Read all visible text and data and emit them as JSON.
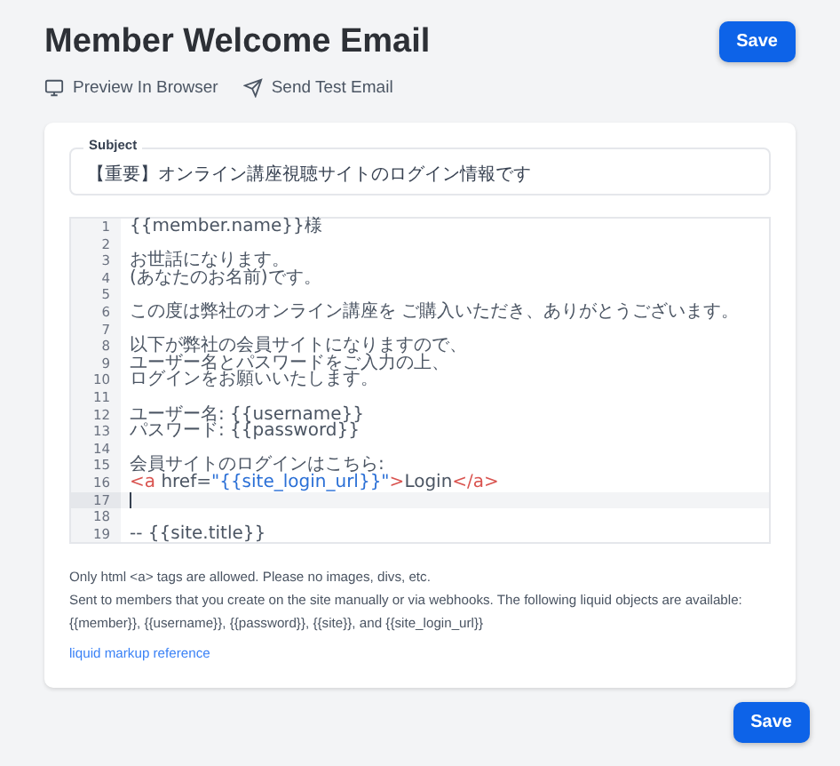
{
  "header": {
    "title": "Member Welcome Email",
    "save": "Save"
  },
  "actions": [
    {
      "kind": "preview",
      "label": "Preview In Browser"
    },
    {
      "kind": "send",
      "label": "Send Test Email"
    }
  ],
  "subject": {
    "label": "Subject",
    "value": "【重要】オンライン講座視聴サイトのログイン情報です"
  },
  "editor": {
    "lines": [
      {
        "number": "1",
        "active": false,
        "tokens": [
          {
            "kind": "text",
            "text": "{{member.name}}様"
          }
        ]
      },
      {
        "number": "2",
        "active": false
      },
      {
        "number": "3",
        "active": false,
        "tokens": [
          {
            "kind": "text",
            "text": "お世話になります。"
          }
        ]
      },
      {
        "number": "4",
        "active": false,
        "tokens": [
          {
            "kind": "text",
            "text": "(あなたのお名前)です。"
          }
        ]
      },
      {
        "number": "5",
        "active": false
      },
      {
        "number": "6",
        "active": false,
        "tokens": [
          {
            "kind": "text",
            "text": "この度は弊社のオンライン講座を ご購入いただき、ありがとうございます。"
          }
        ]
      },
      {
        "number": "7",
        "active": false
      },
      {
        "number": "8",
        "active": false,
        "tokens": [
          {
            "kind": "text",
            "text": "以下が弊社の会員サイトになりますので、"
          }
        ]
      },
      {
        "number": "9",
        "active": false,
        "tokens": [
          {
            "kind": "text",
            "text": "ユーザー名とパスワードをご入力の上、"
          }
        ]
      },
      {
        "number": "10",
        "active": false,
        "tokens": [
          {
            "kind": "text",
            "text": "ログインをお願いいたします。"
          }
        ]
      },
      {
        "number": "11",
        "active": false
      },
      {
        "number": "12",
        "active": false,
        "tokens": [
          {
            "kind": "text",
            "text": "ユーザー名: {{username}}"
          }
        ]
      },
      {
        "number": "13",
        "active": false,
        "tokens": [
          {
            "kind": "text",
            "text": "パスワード: {{password}}"
          }
        ]
      },
      {
        "number": "14",
        "active": false
      },
      {
        "number": "15",
        "active": false,
        "tokens": [
          {
            "kind": "text",
            "text": "会員サイトのログインはこちら:"
          }
        ]
      },
      {
        "number": "16",
        "active": false,
        "tokens": [
          {
            "kind": "tag",
            "text": "<a"
          },
          {
            "kind": "attr",
            "text": " href="
          },
          {
            "kind": "string",
            "text": "\"{{site_login_url}}\""
          },
          {
            "kind": "tag",
            "text": ">"
          },
          {
            "kind": "text",
            "text": "Login"
          },
          {
            "kind": "tag",
            "text": "</a>"
          }
        ]
      },
      {
        "number": "17",
        "active": true
      },
      {
        "number": "18",
        "active": false
      },
      {
        "number": "19",
        "active": false,
        "tokens": [
          {
            "kind": "text",
            "text": "-- {{site.title}}"
          }
        ]
      }
    ]
  },
  "help": [
    "Only html <a> tags are allowed. Please no images, divs, etc.",
    "Sent to members that you create on the site manually or via webhooks. The following liquid objects are available: {{member}}, {{username}}, {{password}}, {{site}}, and {{site_login_url}}"
  ],
  "reference_link": "liquid markup reference",
  "footer": {
    "save": "Save"
  }
}
